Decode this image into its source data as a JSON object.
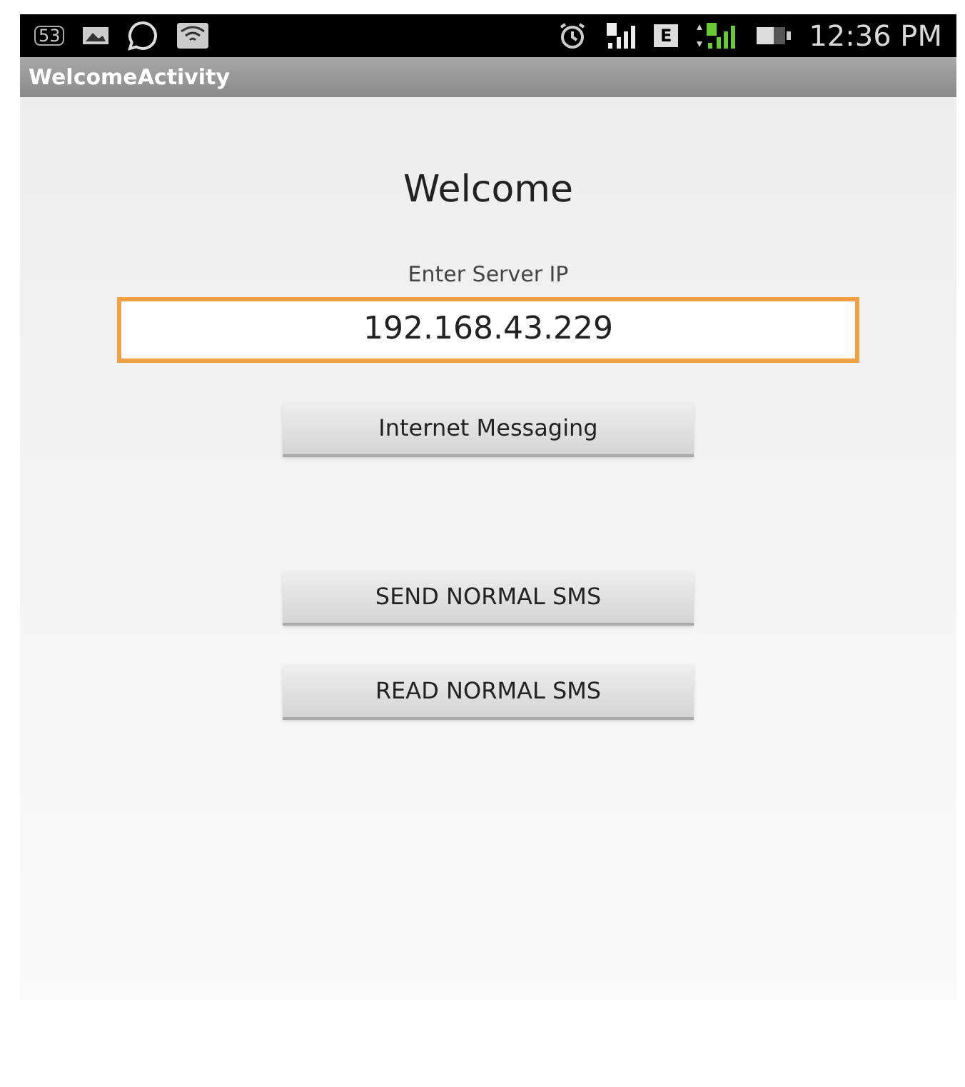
{
  "status_bar": {
    "notification_count": "53",
    "network_type": "E",
    "time": "12:36 PM"
  },
  "action_bar": {
    "title": "WelcomeActivity"
  },
  "heading": "Welcome",
  "server_field": {
    "label": "Enter Server IP",
    "value": "192.168.43.229",
    "focused": true
  },
  "buttons": [
    {
      "label": "Internet Messaging"
    },
    {
      "label": "SEND NORMAL SMS"
    },
    {
      "label": "READ NORMAL SMS"
    }
  ]
}
